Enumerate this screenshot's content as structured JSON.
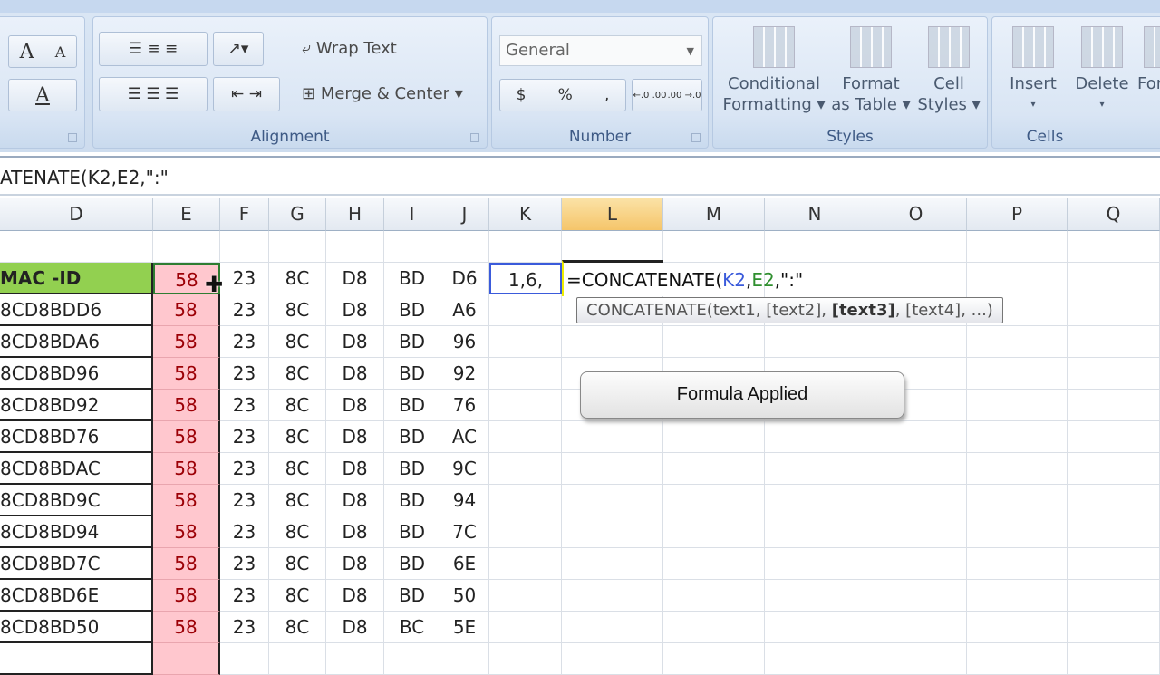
{
  "ribbon": {
    "font_group": {
      "grow_font": "A",
      "shrink_font": "A",
      "font_color": "A"
    },
    "alignment": {
      "label": "Alignment",
      "wrap_text": "Wrap Text",
      "merge_center": "Merge & Center"
    },
    "number": {
      "label": "Number",
      "format": "General",
      "currency": "$",
      "percent": "%",
      "comma": ",",
      "inc_decimal": "←.0 .00",
      "dec_decimal": ".00 →.0"
    },
    "styles": {
      "label": "Styles",
      "conditional": [
        "Conditional",
        "Formatting"
      ],
      "format_table": [
        "Format",
        "as Table"
      ],
      "cell_styles": [
        "Cell",
        "Styles"
      ]
    },
    "cells": {
      "label": "Cells",
      "insert": "Insert",
      "delete": "Delete",
      "format": "For"
    }
  },
  "formula_bar": {
    "text": "ATENATE(K2,E2,\":\""
  },
  "columns": [
    "D",
    "E",
    "F",
    "G",
    "H",
    "I",
    "J",
    "K",
    "L",
    "M",
    "N",
    "O",
    "P",
    "Q"
  ],
  "selected_column": "L",
  "rows": [
    [
      "MAC -ID",
      "58",
      "23",
      "8C",
      "D8",
      "BD",
      "D6"
    ],
    [
      "8CD8BDD6",
      "58",
      "23",
      "8C",
      "D8",
      "BD",
      "A6"
    ],
    [
      "8CD8BDA6",
      "58",
      "23",
      "8C",
      "D8",
      "BD",
      "96"
    ],
    [
      "8CD8BD96",
      "58",
      "23",
      "8C",
      "D8",
      "BD",
      "92"
    ],
    [
      "8CD8BD92",
      "58",
      "23",
      "8C",
      "D8",
      "BD",
      "76"
    ],
    [
      "8CD8BD76",
      "58",
      "23",
      "8C",
      "D8",
      "BD",
      "AC"
    ],
    [
      "8CD8BDAC",
      "58",
      "23",
      "8C",
      "D8",
      "BD",
      "9C"
    ],
    [
      "8CD8BD9C",
      "58",
      "23",
      "8C",
      "D8",
      "BD",
      "94"
    ],
    [
      "8CD8BD94",
      "58",
      "23",
      "8C",
      "D8",
      "BD",
      "7C"
    ],
    [
      "8CD8BD7C",
      "58",
      "23",
      "8C",
      "D8",
      "BD",
      "6E"
    ],
    [
      "8CD8BD6E",
      "58",
      "23",
      "8C",
      "D8",
      "BD",
      "50"
    ],
    [
      "8CD8BD50",
      "58",
      "23",
      "8C",
      "D8",
      "BC",
      "5E"
    ]
  ],
  "k2_value": "1,6,",
  "edit_cell": {
    "prefix": "=CONCATENATE(",
    "ref1": "K2",
    "sep1": ",",
    "ref2": "E2",
    "suffix": ",\":\""
  },
  "tooltip": {
    "fn": "CONCATENATE(text1, [text2], ",
    "current": "[text3]",
    "rest": ", [text4], ...)"
  },
  "overlay": "Formula Applied",
  "colors": {
    "header_fill": "#92d050",
    "highlight_fill": "#ffc7ce",
    "highlight_text": "#9c0006",
    "ref1": "#3b5bdb",
    "ref2": "#2f8f2f"
  }
}
